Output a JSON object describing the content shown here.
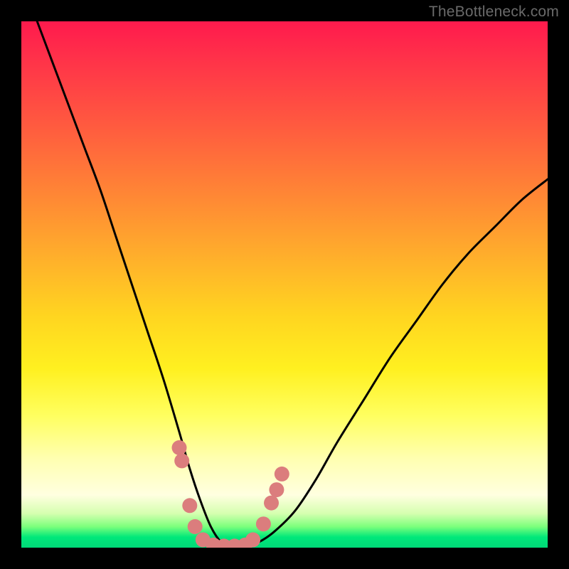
{
  "watermark": "TheBottleneck.com",
  "chart_data": {
    "type": "line",
    "title": "",
    "xlabel": "",
    "ylabel": "",
    "xlim": [
      0,
      100
    ],
    "ylim": [
      0,
      100
    ],
    "grid": false,
    "legend": false,
    "series": [
      {
        "name": "curve",
        "color": "#000000",
        "x": [
          3,
          6,
          9,
          12,
          15,
          18,
          21,
          24,
          27,
          30,
          32,
          34,
          36,
          38,
          40,
          42,
          45,
          48,
          52,
          56,
          60,
          65,
          70,
          75,
          80,
          85,
          90,
          95,
          100
        ],
        "y": [
          100,
          92,
          84,
          76,
          68,
          59,
          50,
          41,
          32,
          22,
          15,
          9,
          4,
          1,
          0,
          0,
          1,
          3,
          7,
          13,
          20,
          28,
          36,
          43,
          50,
          56,
          61,
          66,
          70
        ]
      }
    ],
    "markers": {
      "name": "bottom-cluster",
      "color": "#db7d7d",
      "points": [
        {
          "x": 30.0,
          "y": 19.0
        },
        {
          "x": 30.5,
          "y": 16.5
        },
        {
          "x": 32.0,
          "y": 8.0
        },
        {
          "x": 33.0,
          "y": 4.0
        },
        {
          "x": 34.5,
          "y": 1.5
        },
        {
          "x": 36.5,
          "y": 0.5
        },
        {
          "x": 38.5,
          "y": 0.3
        },
        {
          "x": 40.5,
          "y": 0.3
        },
        {
          "x": 42.5,
          "y": 0.5
        },
        {
          "x": 44.0,
          "y": 1.5
        },
        {
          "x": 46.0,
          "y": 4.5
        },
        {
          "x": 47.5,
          "y": 8.5
        },
        {
          "x": 48.5,
          "y": 11.0
        },
        {
          "x": 49.5,
          "y": 14.0
        }
      ]
    }
  }
}
